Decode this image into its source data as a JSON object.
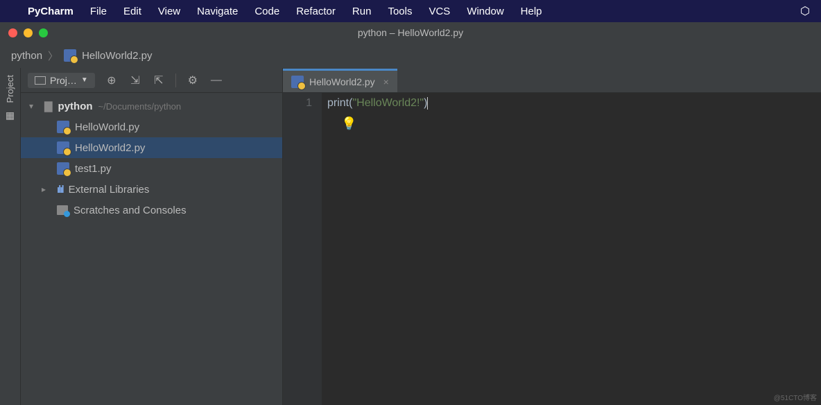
{
  "menubar": {
    "app_name": "PyCharm",
    "items": [
      "File",
      "Edit",
      "View",
      "Navigate",
      "Code",
      "Refactor",
      "Run",
      "Tools",
      "VCS",
      "Window",
      "Help"
    ]
  },
  "window": {
    "title": "python – HelloWorld2.py"
  },
  "breadcrumb": {
    "root": "python",
    "file": "HelloWorld2.py"
  },
  "project_panel": {
    "title": "Proj…",
    "tree": {
      "root_label": "python",
      "root_path": "~/Documents/python",
      "files": [
        "HelloWorld.py",
        "HelloWorld2.py",
        "test1.py"
      ],
      "selected_index": 1,
      "external_libs": "External Libraries",
      "scratches": "Scratches and Consoles"
    }
  },
  "editor": {
    "tab_label": "HelloWorld2.py",
    "gutter": [
      "1"
    ],
    "code": {
      "fn": "print",
      "open_paren": "(",
      "string": "\"HelloWorld2!\"",
      "close_paren": ")"
    }
  },
  "left_tab": {
    "label": "Project"
  },
  "watermark": "@51CTO博客"
}
